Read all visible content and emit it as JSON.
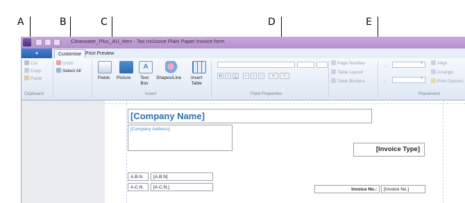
{
  "callouts": [
    "A",
    "B",
    "C",
    "D",
    "E"
  ],
  "window": {
    "title": "Clearwater_Plus_AU_Item - Tax Inclusive Plain Paper Invoice  form"
  },
  "tabs": {
    "file_label": "",
    "customise": "Customise",
    "print_preview": "Print Preview"
  },
  "ribbon": {
    "clipboard": {
      "cut": "Cut",
      "copy": "Copy",
      "paste": "Paste",
      "label": "Clipboard"
    },
    "editing": {
      "undo": "Undo",
      "select_all": "Select All"
    },
    "insert": {
      "fields": "Fields",
      "picture": "Picture",
      "text_box_line1": "Text",
      "text_box_line2": "Box",
      "shapes_line": "Shapes/Line",
      "insert_table_line1": "Insert",
      "insert_table_line2": "Table",
      "label": "Insert"
    },
    "field_properties": {
      "label": "Field Properties",
      "bold": "B",
      "italic": "I",
      "underline": "U"
    },
    "page": {
      "page_number": "Page Number",
      "table_layout": "Table Layout",
      "table_borders": "Table Borders"
    },
    "placement": {
      "align": "Align",
      "arrange": "Arrange",
      "print_options": "Print Options",
      "label": "Placement"
    }
  },
  "form": {
    "company_name": "[Company Name]",
    "company_address": "[Company Address]",
    "abn_label": "A.B.N.",
    "abn_value": "[A.B.N]",
    "acn_label": "A.C.N.",
    "acn_value": "[A.C.N.]",
    "invoice_type": "[Invoice Type]",
    "invoice_no_label": "Invoice No.:",
    "invoice_no_value": "[Invoice No.]"
  },
  "colors": {
    "title_bar": "#b491cc",
    "file_tab": "#2a5fb5",
    "company_name_text": "#2d6fb1",
    "company_address_text": "#3c8fd0",
    "grid_lines": "#c5d6ea"
  }
}
